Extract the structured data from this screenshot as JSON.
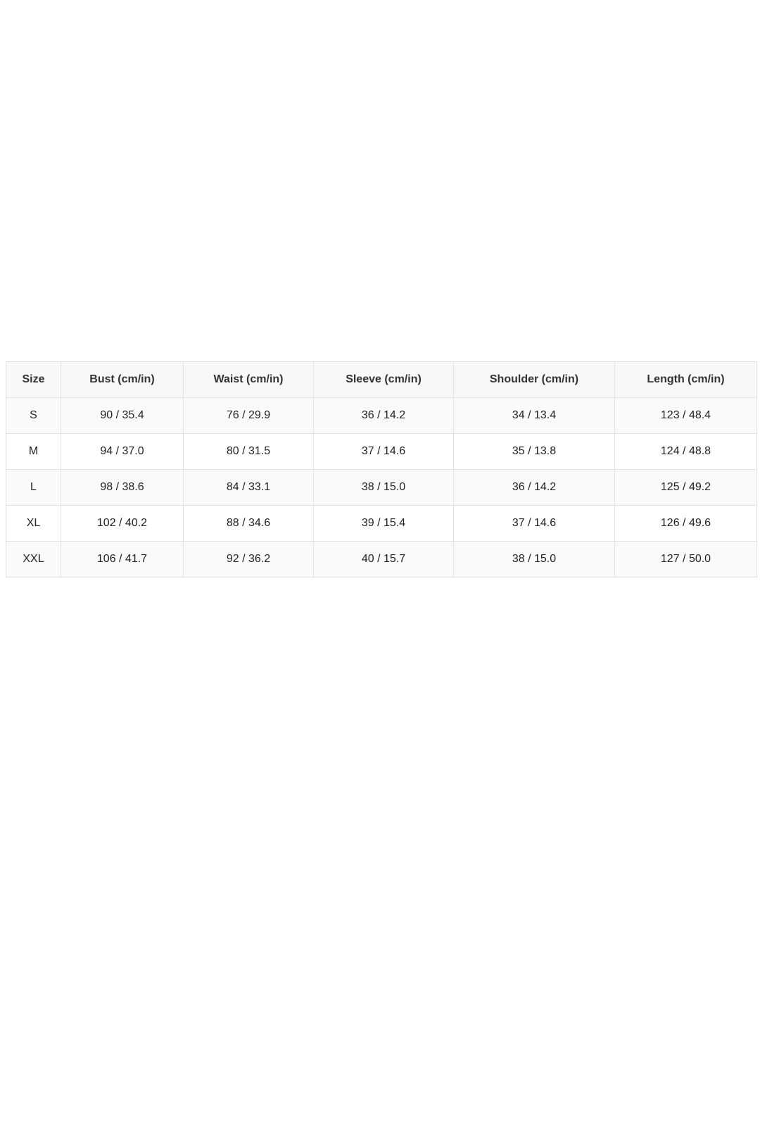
{
  "size_chart": {
    "headers": [
      "Size",
      "Bust (cm/in)",
      "Waist (cm/in)",
      "Sleeve (cm/in)",
      "Shoulder (cm/in)",
      "Length (cm/in)"
    ],
    "rows": [
      [
        "S",
        "90 / 35.4",
        "76 / 29.9",
        "36 / 14.2",
        "34 / 13.4",
        "123 / 48.4"
      ],
      [
        "M",
        "94 / 37.0",
        "80 / 31.5",
        "37 / 14.6",
        "35 / 13.8",
        "124 / 48.8"
      ],
      [
        "L",
        "98 / 38.6",
        "84 / 33.1",
        "38 / 15.0",
        "36 / 14.2",
        "125 / 49.2"
      ],
      [
        "XL",
        "102 / 40.2",
        "88 / 34.6",
        "39 / 15.4",
        "37 / 14.6",
        "126 / 49.6"
      ],
      [
        "XXL",
        "106 / 41.7",
        "92 / 36.2",
        "40 / 15.7",
        "38 / 15.0",
        "127 / 50.0"
      ]
    ]
  }
}
